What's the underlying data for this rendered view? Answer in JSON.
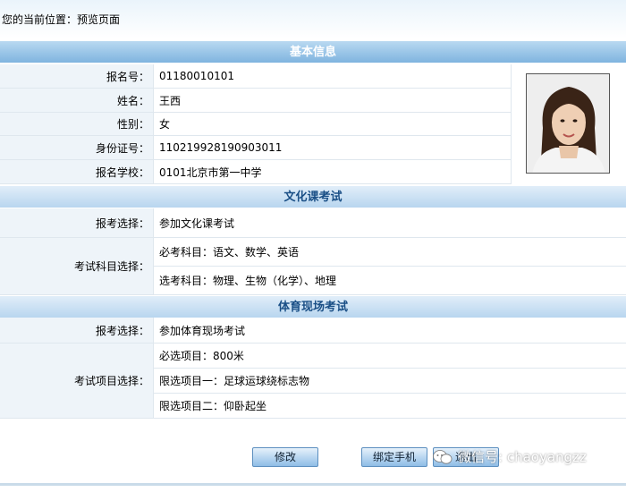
{
  "location": {
    "text": "您的当前位置：预览页面"
  },
  "sections": {
    "basic": "基本信息",
    "culture": "文化课考试",
    "sports": "体育现场考试"
  },
  "basic_info": [
    {
      "label": "报名号：",
      "value": "01180010101"
    },
    {
      "label": "姓名：",
      "value": "王西"
    },
    {
      "label": "性别：",
      "value": "女"
    },
    {
      "label": "身份证号：",
      "value": "110219928190903011"
    },
    {
      "label": "报名学校：",
      "value": "0101北京市第一中学"
    }
  ],
  "culture": {
    "choice_label": "报考选择：",
    "choice_value": "参加文化课考试",
    "subjects_label": "考试科目选择：",
    "required": "必考科目：语文、数学、英语",
    "optional": "选考科目：物理、生物（化学）、地理"
  },
  "sports": {
    "choice_label": "报考选择：",
    "choice_value": "参加体育现场考试",
    "items_label": "考试项目选择：",
    "item1": "必选项目：800米",
    "item2": "限选项目一：足球运球绕标志物",
    "item3": "限选项目二：仰卧起坐"
  },
  "buttons": {
    "edit": "修改",
    "bind_phone": "绑定手机",
    "exit": "退出"
  },
  "watermark": {
    "text": "微信号: chaoyangzz"
  }
}
